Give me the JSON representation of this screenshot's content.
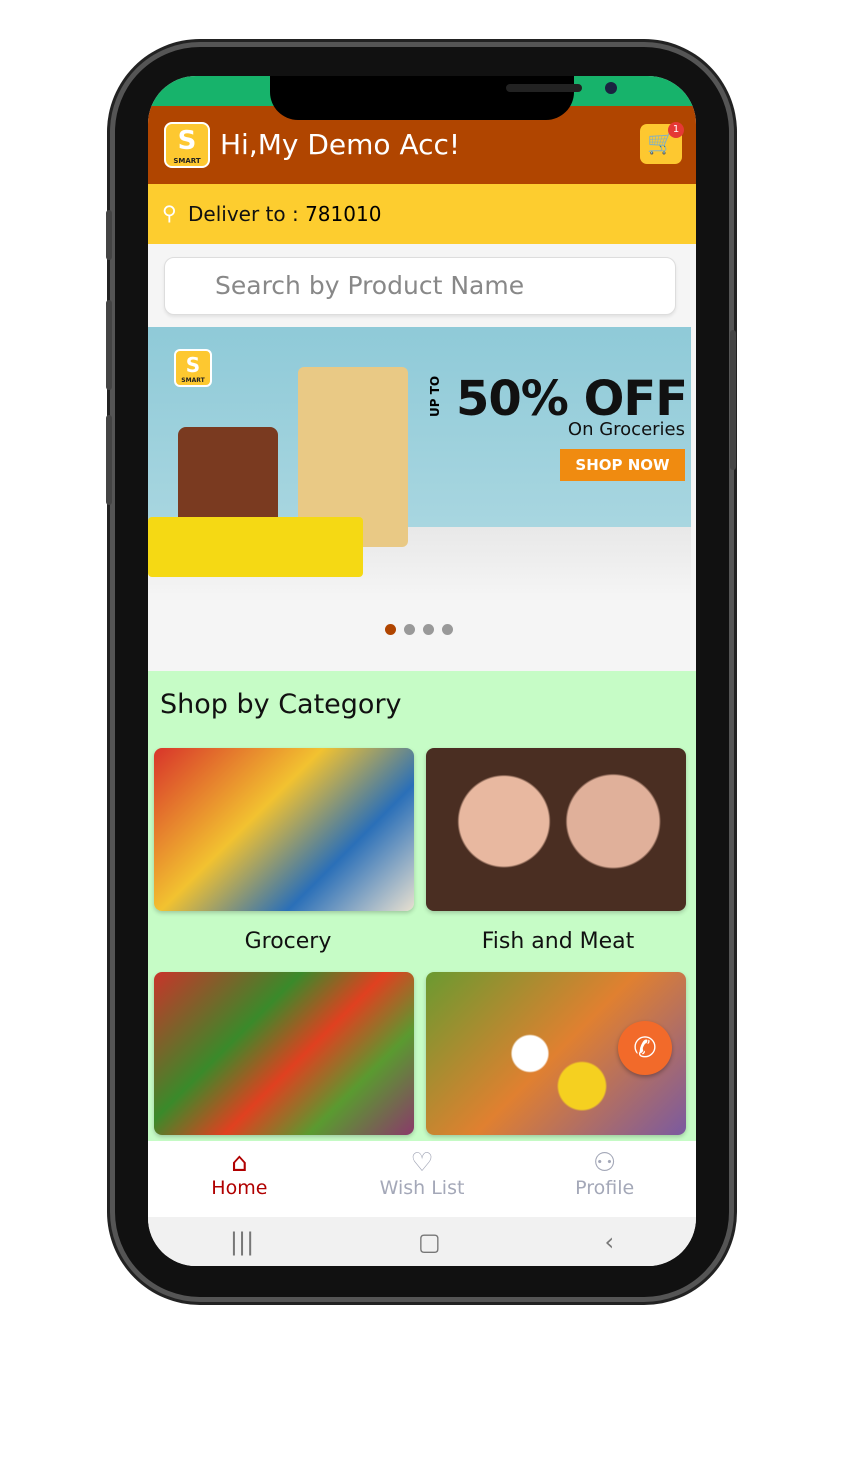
{
  "header": {
    "logo_text": "S",
    "logo_caption": "SMART",
    "greeting": "Hi,My Demo Acc!",
    "cart_count": "1",
    "cart_icon": "cart-icon"
  },
  "delivery": {
    "label": "Deliver to : ",
    "pincode": "781010",
    "icon": "location-pin-icon"
  },
  "search": {
    "placeholder": "Search by Product Name"
  },
  "banner": {
    "logo_text": "S",
    "logo_caption": "SMART",
    "up_to": "UP TO",
    "headline": "50% OFF",
    "subline": "On Groceries",
    "cta": "SHOP NOW",
    "slides": 4,
    "active_slide": 1
  },
  "categories": {
    "title": "Shop by Category",
    "items": [
      {
        "label": "Grocery"
      },
      {
        "label": "Fish and Meat"
      },
      {
        "label": ""
      },
      {
        "label": ""
      }
    ]
  },
  "bottom_nav": [
    {
      "label": "Home",
      "icon": "home-icon",
      "active": true
    },
    {
      "label": "Wish List",
      "icon": "heart-icon"
    },
    {
      "label": "Profile",
      "icon": "person-icon"
    }
  ],
  "colors": {
    "header": "#b04500",
    "delivery_bar": "#fdcd2f",
    "category_bg": "#c6fcc6",
    "active_nav": "#b00000",
    "status_bar": "#17b36b"
  }
}
